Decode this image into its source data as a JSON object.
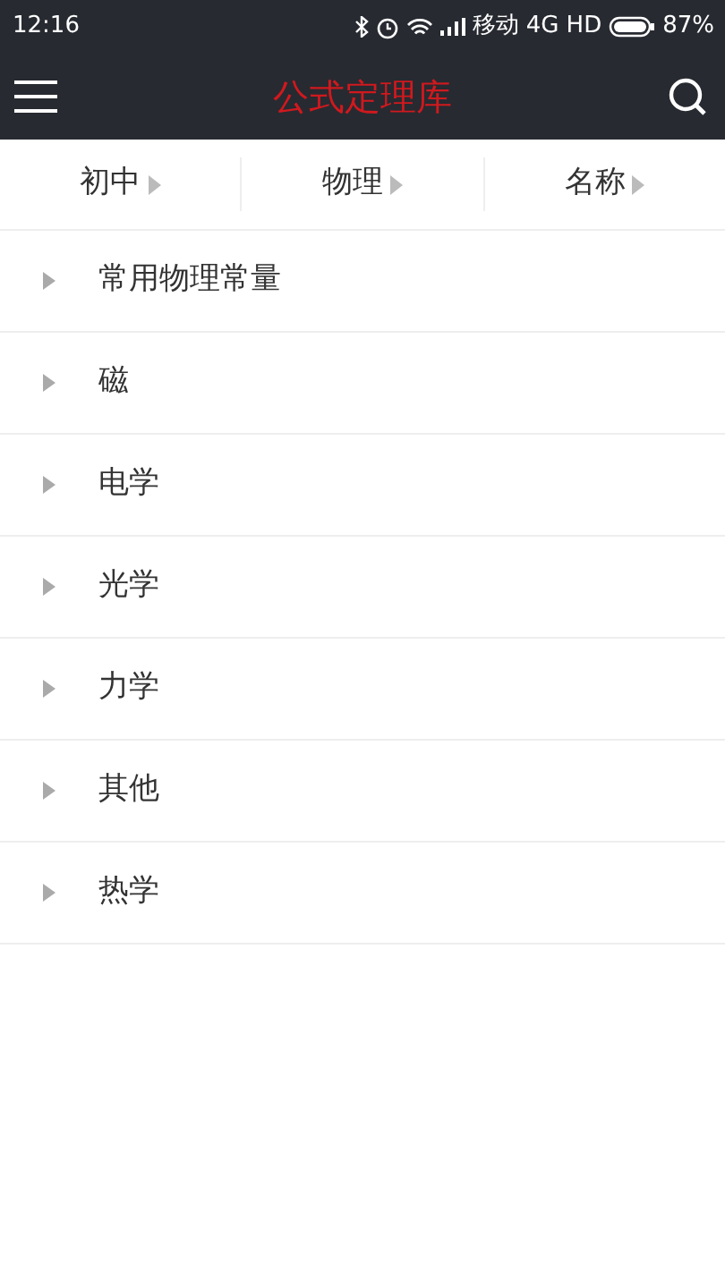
{
  "status_bar": {
    "time": "12:16",
    "carrier": "移动",
    "network": "4G HD",
    "battery": "87%"
  },
  "header": {
    "title": "公式定理库"
  },
  "filters": [
    {
      "label": "初中"
    },
    {
      "label": "物理"
    },
    {
      "label": "名称"
    }
  ],
  "categories": [
    {
      "label": "常用物理常量",
      "expanded": false
    },
    {
      "label": "磁",
      "expanded": false
    },
    {
      "label": "电学",
      "expanded": false
    },
    {
      "label": "光学",
      "expanded": false
    },
    {
      "label": "力学",
      "expanded": false
    },
    {
      "label": "其他",
      "expanded": false
    },
    {
      "label": "热学",
      "expanded": false
    }
  ]
}
